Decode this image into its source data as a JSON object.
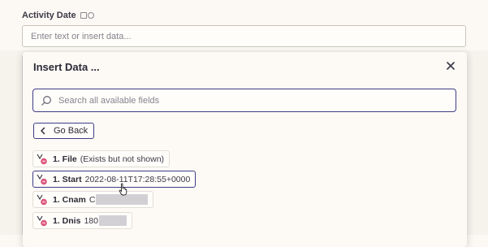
{
  "field": {
    "label": "Activity Date",
    "placeholder": "Enter text or insert data..."
  },
  "modal": {
    "title": "Insert Data ...",
    "close_icon": "close-icon",
    "search_placeholder": "Search all available fields",
    "go_back_label": "Go Back",
    "items": [
      {
        "step": "1. File",
        "value": "(Exists but not shown)",
        "redacted": false,
        "selected": false
      },
      {
        "step": "1. Start",
        "value": "2022-08-11T17:28:55+0000",
        "redacted": false,
        "selected": true
      },
      {
        "step": "1. Cnam",
        "value": "C",
        "redacted": true,
        "selected": false
      },
      {
        "step": "1. Dnis",
        "value": "180",
        "redacted": true,
        "selected": false
      }
    ]
  },
  "colors": {
    "accent": "#3f3c86",
    "background": "#fcf9f4",
    "app_icon_pink": "#d9527a"
  }
}
